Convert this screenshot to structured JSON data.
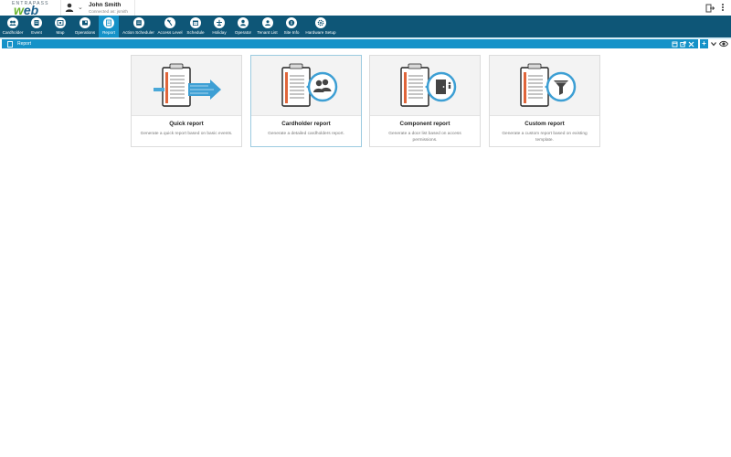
{
  "header": {
    "brand_top": "ENTRAPASS",
    "brand_main_a": "w",
    "brand_main_b": "eb",
    "user_name": "John Smith",
    "user_connection": "Connected as: jsmith"
  },
  "toolbar": {
    "items": [
      {
        "label": "Cardholder",
        "icon": "cardholder-icon"
      },
      {
        "label": "Event",
        "icon": "event-icon"
      },
      {
        "label": "Map",
        "icon": "map-icon"
      },
      {
        "label": "Operations",
        "icon": "operations-icon"
      },
      {
        "label": "Report",
        "icon": "report-icon",
        "active": true
      },
      {
        "label": "Action Scheduler",
        "icon": "action-scheduler-icon"
      },
      {
        "label": "Access Level",
        "icon": "access-level-icon"
      },
      {
        "label": "Schedule",
        "icon": "schedule-icon"
      },
      {
        "label": "Holiday",
        "icon": "holiday-icon"
      },
      {
        "label": "Operator",
        "icon": "operator-icon"
      },
      {
        "label": "Tenant List",
        "icon": "tenant-list-icon"
      },
      {
        "label": "Site Info",
        "icon": "site-info-icon"
      },
      {
        "label": "Hardware Setup",
        "icon": "hardware-setup-icon"
      }
    ]
  },
  "tab": {
    "title": "Report",
    "add_label": "+"
  },
  "cards": [
    {
      "title": "Quick report",
      "description": "Generate a quick report based on basic events.",
      "icon": "quick-report-icon"
    },
    {
      "title": "Cardholder report",
      "description": "Generate a detailed cardholders report.",
      "icon": "cardholder-report-icon",
      "selected": true
    },
    {
      "title": "Component report",
      "description": "Generate a door list based on access permissions.",
      "icon": "component-report-icon"
    },
    {
      "title": "Custom report",
      "description": "Generate a custom report based on existing template.",
      "icon": "custom-report-icon"
    }
  ],
  "colors": {
    "toolbar_bg": "#0e5677",
    "accent": "#1592c8",
    "card_bg": "#f3f3f3",
    "report_orange": "#e0653a"
  }
}
